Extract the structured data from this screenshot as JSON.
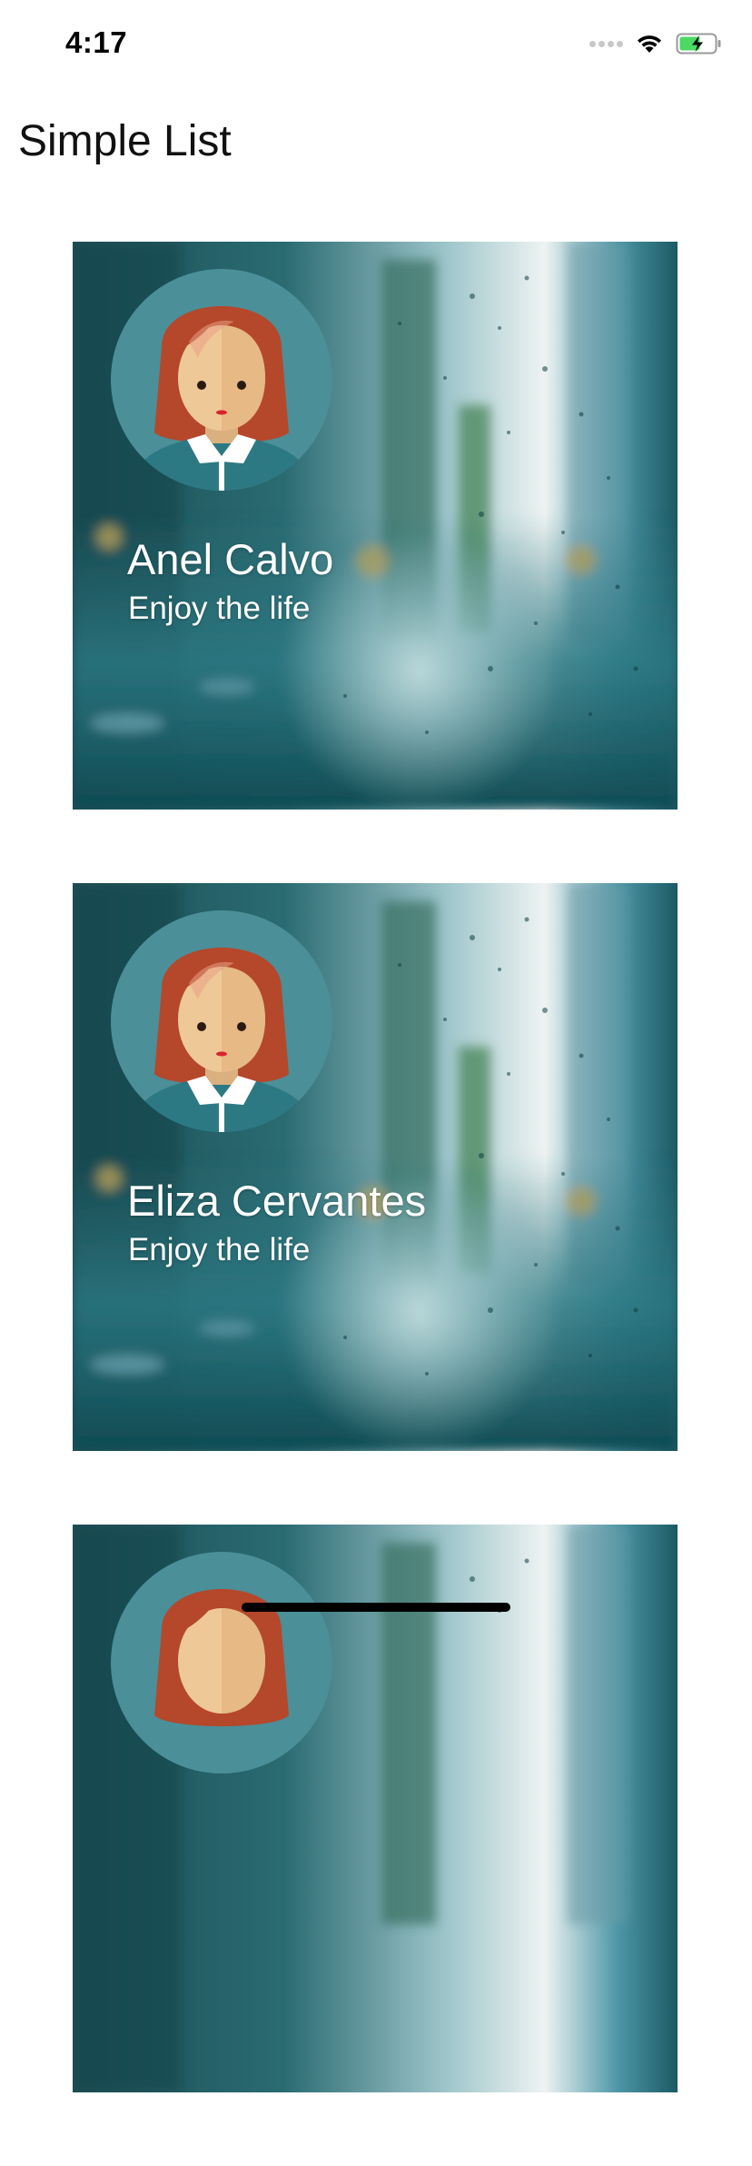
{
  "status_bar": {
    "time": "4:17",
    "icons": [
      "cellular-signal-icon",
      "wifi-icon",
      "battery-charging-icon"
    ]
  },
  "header": {
    "title": "Simple List"
  },
  "list": {
    "items": [
      {
        "name": "Anel Calvo",
        "tagline": "Enjoy the life"
      },
      {
        "name": "Eliza Cervantes",
        "tagline": "Enjoy the life"
      },
      {
        "name": "",
        "tagline": ""
      }
    ]
  },
  "colors": {
    "card_teal": "#1f6570",
    "hair": "#b5472b",
    "skin": "#efc898",
    "avatar_circle": "#4b8f98",
    "battery_fill": "#4cd964"
  }
}
